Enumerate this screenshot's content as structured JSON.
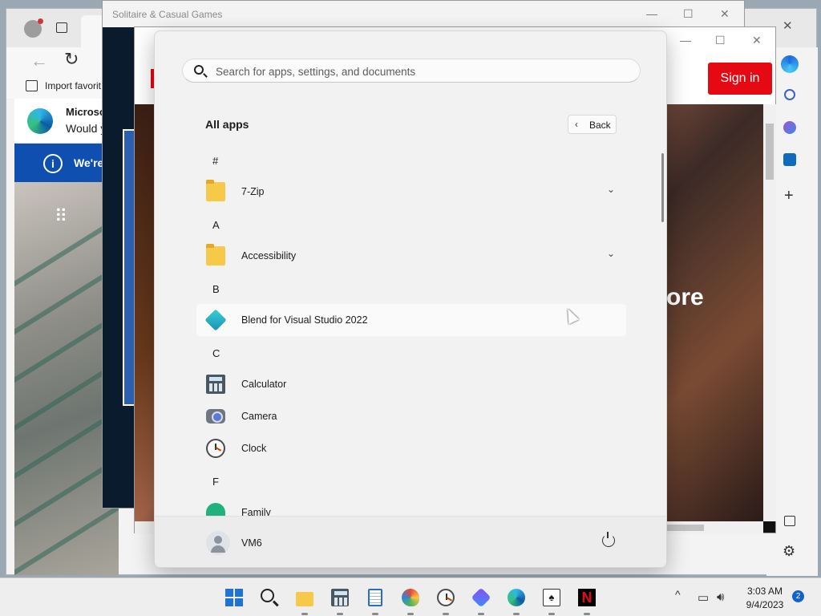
{
  "edge": {
    "favorites_label": "Import favorit",
    "notification_title": "Microso",
    "notification_text": "Would y",
    "infobar_text": "We're",
    "window_close": "✕",
    "window_min": "—",
    "window_max": "☐"
  },
  "solitaire": {
    "title": "Solitaire & Casual Games",
    "min": "—",
    "max": "☐",
    "close": "✕"
  },
  "netflix": {
    "signin_label": "Sign in",
    "hero_text": "ore",
    "min": "—",
    "max": "☐",
    "close": "✕"
  },
  "start_menu": {
    "search_placeholder": "Search for apps, settings, and documents",
    "all_apps_title": "All apps",
    "back_label": "Back",
    "user_name": "VM6",
    "groups": [
      {
        "letter": "#",
        "apps": [
          {
            "name": "7-Zip",
            "icon": "folder-icon",
            "expandable": true
          }
        ]
      },
      {
        "letter": "A",
        "apps": [
          {
            "name": "Accessibility",
            "icon": "folder-icon",
            "expandable": true
          }
        ]
      },
      {
        "letter": "B",
        "apps": [
          {
            "name": "Blend for Visual Studio 2022",
            "icon": "blend-icon",
            "expandable": false
          }
        ]
      },
      {
        "letter": "C",
        "apps": [
          {
            "name": "Calculator",
            "icon": "calculator-icon",
            "expandable": false
          },
          {
            "name": "Camera",
            "icon": "camera-icon",
            "expandable": false
          },
          {
            "name": "Clock",
            "icon": "clock-icon",
            "expandable": false
          }
        ]
      },
      {
        "letter": "F",
        "apps": [
          {
            "name": "Family",
            "icon": "family-icon",
            "expandable": false
          }
        ]
      }
    ]
  },
  "taskbar": {
    "apps": [
      "start-icon",
      "search-icon",
      "file-explorer-icon",
      "calculator-icon",
      "notepad-icon",
      "paint-icon",
      "clock-icon",
      "copilot-icon",
      "edge-icon",
      "solitaire-icon",
      "netflix-icon"
    ],
    "tray_chevron": "^",
    "time": "3:03 AM",
    "date": "9/4/2023",
    "notification_count": "2"
  },
  "colors": {
    "accent": "#1d74d6",
    "netflix_red": "#e50914",
    "edge_infobar": "#0e4fb0"
  }
}
